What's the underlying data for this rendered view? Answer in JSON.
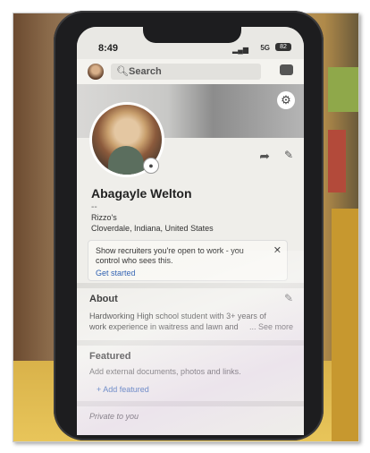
{
  "status_bar": {
    "time": "8:49",
    "signal": "▂▄▆",
    "network": "5G",
    "battery": "82"
  },
  "top_bar": {
    "search_placeholder": "Search"
  },
  "profile": {
    "name": "Abagayle Welton",
    "headline": "--",
    "company": "Rizzo's",
    "location": "Cloverdale, Indiana, United States"
  },
  "open_to_work": {
    "line1": "Show recruiters you're open to work - you",
    "line2": "control who sees this.",
    "cta": "Get started",
    "close": "✕"
  },
  "about": {
    "heading": "About",
    "line1": "Hardworking High school student with 3+ years of",
    "line2": "work experience in waitress and lawn and",
    "see_more": "... See more"
  },
  "featured": {
    "heading": "Featured",
    "description": "Add external documents, photos and links.",
    "add_label": "+ Add featured"
  },
  "private_label": "Private to you",
  "icons": [
    "search-icon",
    "message-icon",
    "gear-icon",
    "camera-icon",
    "share-icon",
    "pencil-icon",
    "close-icon"
  ]
}
